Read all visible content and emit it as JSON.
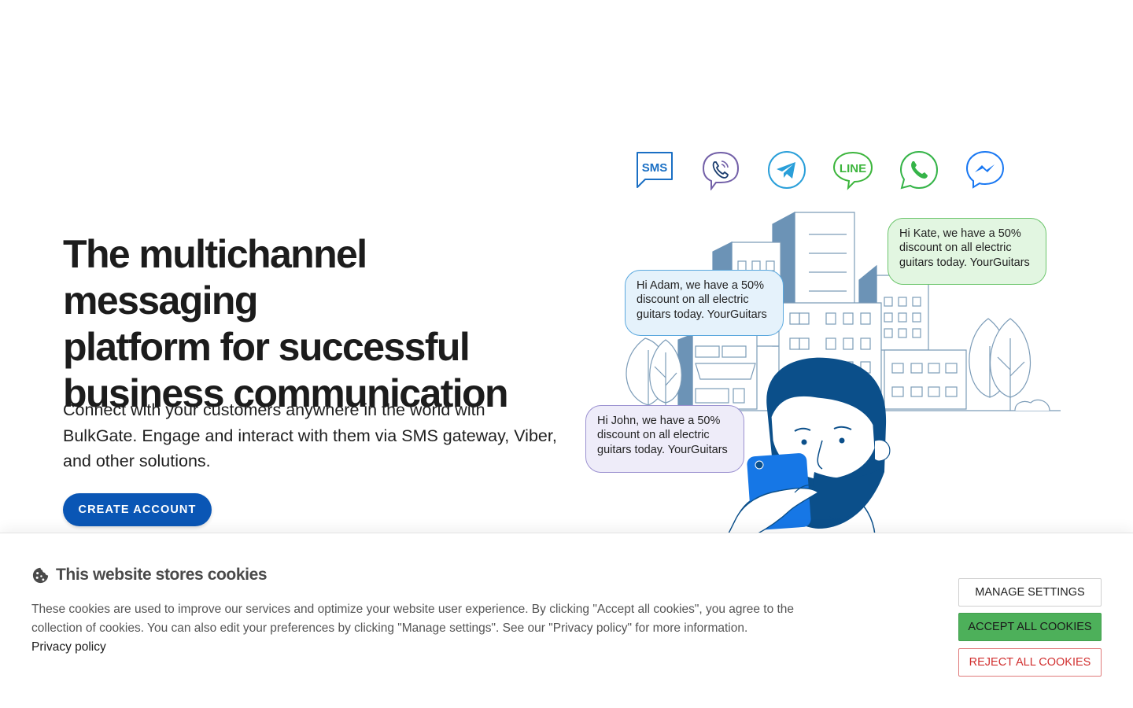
{
  "hero": {
    "title_lines": [
      "The multichannel messaging",
      "platform for successful",
      "business communication"
    ],
    "subtitle_lines": [
      "Connect with your customers anywhere in the world with",
      "BulkGate. Engage and interact with them via SMS gateway, Viber,",
      "and other solutions."
    ],
    "cta_label": "CREATE ACCOUNT"
  },
  "channels": [
    {
      "name": "sms-icon",
      "label": "SMS",
      "color": "#1a6fc4"
    },
    {
      "name": "viber-icon",
      "color": "#7360a8"
    },
    {
      "name": "telegram-icon",
      "color": "#2a9fd9"
    },
    {
      "name": "line-icon",
      "label": "LINE",
      "color": "#3cb53c"
    },
    {
      "name": "whatsapp-icon",
      "color": "#35b448"
    },
    {
      "name": "messenger-icon",
      "color": "#1877f2"
    }
  ],
  "bubbles": {
    "adam": [
      "Hi Adam, we have a 50%",
      "discount on all electric",
      "guitars today. YourGuitars"
    ],
    "kate": [
      "Hi Kate, we have a 50%",
      "discount on all electric",
      "guitars today. YourGuitars"
    ],
    "john": [
      "Hi John, we have a 50%",
      "discount on all electric",
      "guitars today. YourGuitars"
    ]
  },
  "cookies": {
    "title": "This website stores cookies",
    "text_lines": [
      "These cookies are used to improve our services and optimize your website user experience. By clicking \"Accept all cookies\", you agree to the",
      "collection of cookies. You can also edit your preferences by clicking \"Manage settings\". See our \"Privacy policy\" for more information."
    ],
    "privacy_link": "Privacy policy",
    "manage_label": "MANAGE SETTINGS",
    "accept_label": "ACCEPT ALL COOKIES",
    "reject_label": "REJECT ALL COOKIES",
    "accept_color": "#4db05a",
    "reject_color": "#d12f2f"
  }
}
